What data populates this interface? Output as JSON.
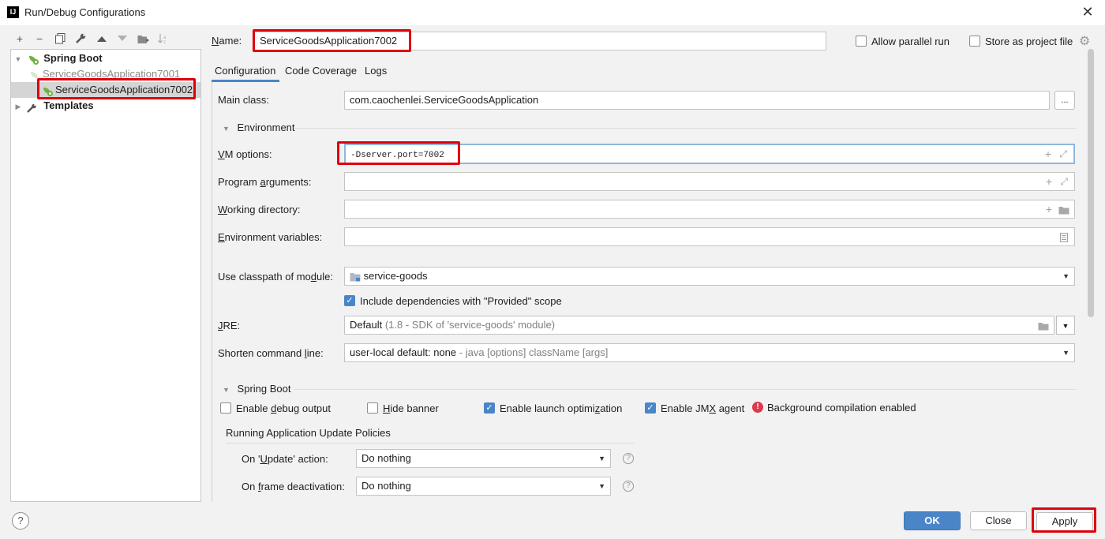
{
  "window": {
    "title": "Run/Debug Configurations",
    "logo_text": "IJ"
  },
  "toolbar": {
    "icons": [
      "plus-icon",
      "minus-icon",
      "copy-icon",
      "wrench-icon",
      "arrow-up-icon",
      "arrow-down-icon",
      "folder-icon",
      "sort-icon"
    ]
  },
  "tree": {
    "group_label": "Spring Boot",
    "items": [
      {
        "label": "ServiceGoodsApplication7001"
      },
      {
        "label": "ServiceGoodsApplication7002"
      }
    ],
    "templates_label": "Templates"
  },
  "header": {
    "name_label": "Name:",
    "name_value": "ServiceGoodsApplication7002",
    "allow_parallel_label": "Allow parallel run",
    "store_project_label": "Store as project file"
  },
  "tabs": [
    {
      "label": "Configuration"
    },
    {
      "label": "Code Coverage"
    },
    {
      "label": "Logs"
    }
  ],
  "config": {
    "main_class_label": "Main class:",
    "main_class_value": "com.caochenlei.ServiceGoodsApplication",
    "browse_button": "...",
    "environment_section": "Environment",
    "vm_options_label": "VM options:",
    "vm_options_value": "-Dserver.port=7002",
    "program_args_label": "Program arguments:",
    "working_dir_label": "Working directory:",
    "env_vars_label": "Environment variables:",
    "classpath_label": "Use classpath of module:",
    "classpath_value": "service-goods",
    "include_deps_label": "Include dependencies with \"Provided\" scope",
    "jre_label": "JRE:",
    "jre_value": "Default",
    "jre_hint": "(1.8 - SDK of 'service-goods' module)",
    "shorten_label": "Shorten command line:",
    "shorten_value": "user-local default: none",
    "shorten_hint": "- java [options] className [args]",
    "spring_section": "Spring Boot",
    "enable_debug_label": "Enable debug output",
    "hide_banner_label": "Hide banner",
    "launch_opt_label": "Enable launch optimization",
    "jmx_label": "Enable JMX agent",
    "bg_compilation_label": "Background compilation enabled",
    "policies_header": "Running Application Update Policies",
    "update_action_label": "On 'Update' action:",
    "update_action_value": "Do nothing",
    "frame_deact_label": "On frame deactivation:",
    "frame_deact_value": "Do nothing"
  },
  "footer": {
    "help": "?",
    "ok": "OK",
    "close": "Close",
    "apply": "Apply"
  },
  "colors": {
    "accent": "#4a86c7",
    "highlight_red": "#e0000b",
    "spring_green": "#6db33f"
  }
}
